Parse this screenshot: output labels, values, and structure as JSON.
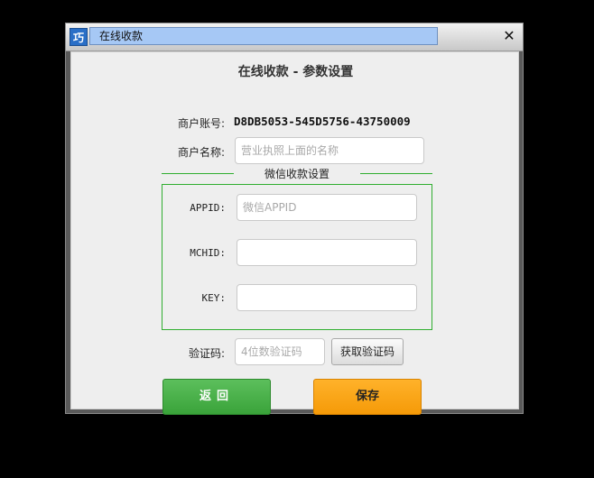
{
  "window": {
    "title": "在线收款",
    "app_icon_glyph": "巧"
  },
  "form": {
    "heading": "在线收款 - 参数设置",
    "merchant_account_label": "商户账号:",
    "merchant_account_value": "D8DB5053-545D5756-43750009",
    "merchant_name_label": "商户名称:",
    "merchant_name_value": "",
    "merchant_name_placeholder": "营业执照上面的名称"
  },
  "wechat_group": {
    "title": "微信收款设置",
    "appid_label": "APPID:",
    "appid_value": "",
    "appid_placeholder": "微信APPID",
    "mchid_label": "MCHID:",
    "mchid_value": "",
    "key_label": "KEY:",
    "key_value": ""
  },
  "verify": {
    "label": "验证码:",
    "value": "",
    "placeholder": "4位数验证码",
    "get_code_button": "获取验证码"
  },
  "buttons": {
    "back": "返回",
    "save": "保存"
  },
  "colors": {
    "group_border": "#2fae2f",
    "back_button": "#3aa33a",
    "save_button": "#f59a08",
    "title_field": "#a6c8f5"
  }
}
